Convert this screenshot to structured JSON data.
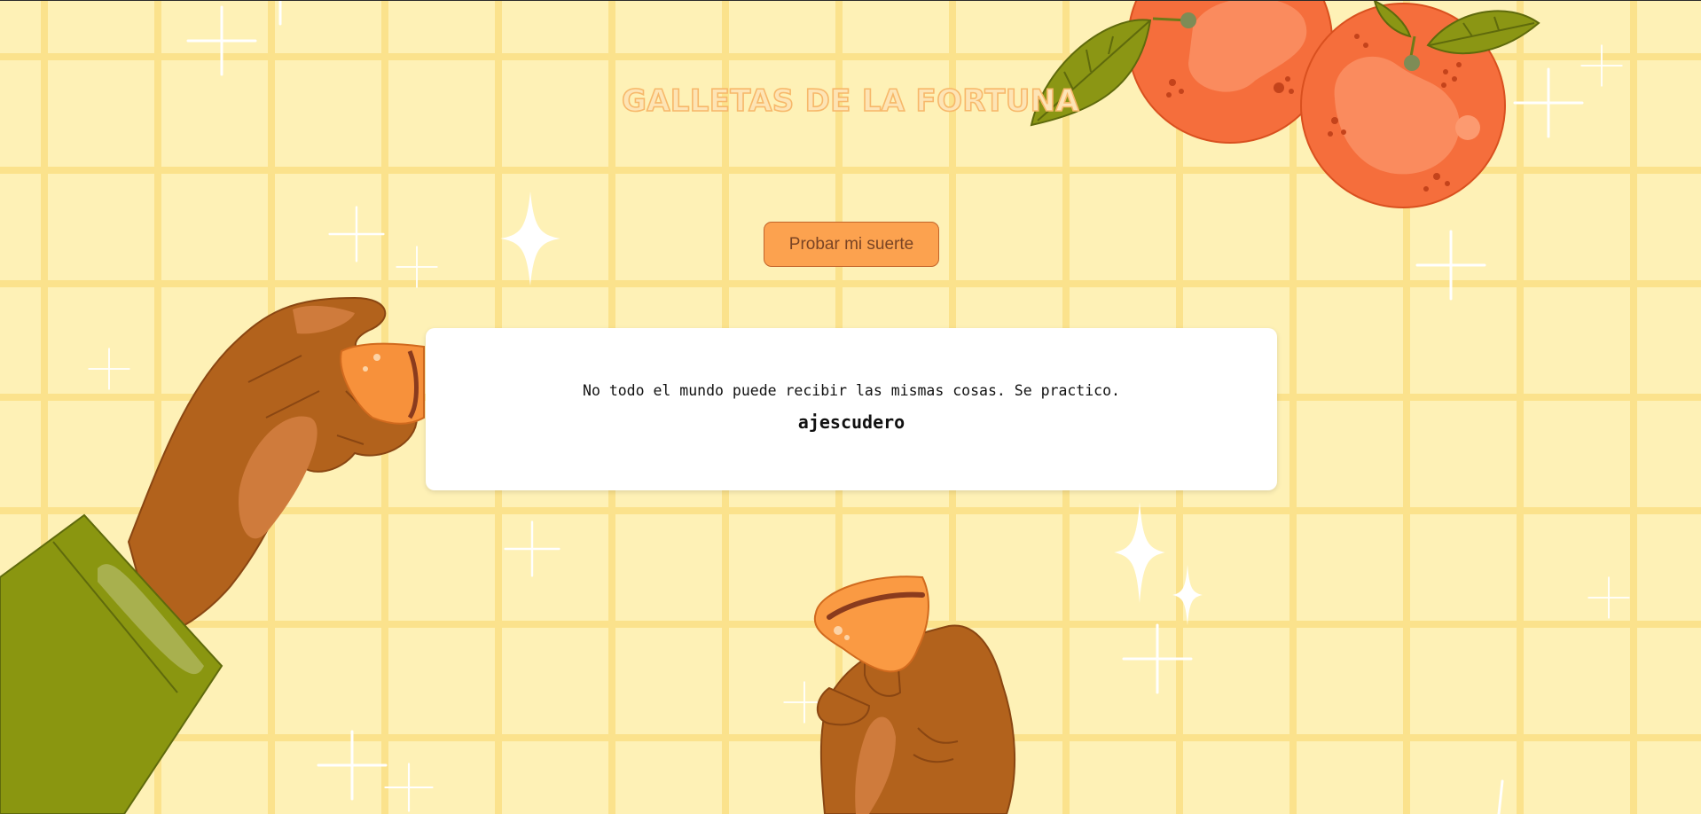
{
  "page": {
    "title": "GALLETAS DE LA FORTUNA",
    "button_label": "Probar mi suerte"
  },
  "fortune": {
    "message": "No todo el mundo puede recibir las mismas cosas. Se practico.",
    "author": "ajescudero"
  },
  "icons": [
    "sparkle-icon",
    "orange-fruit-icon",
    "leaf-icon",
    "hand-icon",
    "fortune-cookie-icon"
  ],
  "colors": {
    "background": "#fef1b6",
    "grid_lines": "#fbe28c",
    "button": "#fca24f",
    "orange": "#f56e3c",
    "leaf": "#8b9614",
    "skin": "#b2621c",
    "sleeve": "#8a9610"
  }
}
